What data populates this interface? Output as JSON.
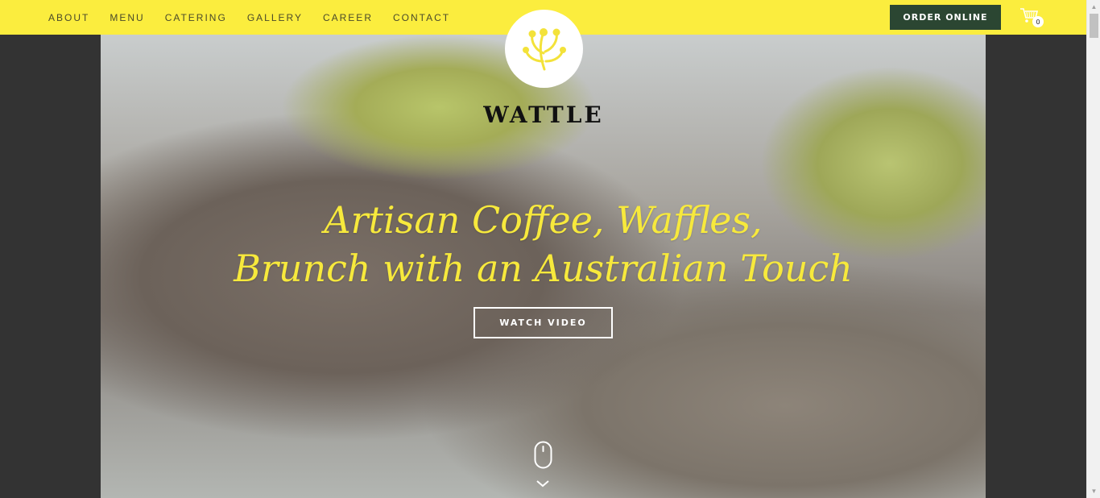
{
  "nav": {
    "items": [
      {
        "label": "ABOUT"
      },
      {
        "label": "MENU"
      },
      {
        "label": "CATERING"
      },
      {
        "label": "GALLERY"
      },
      {
        "label": "CAREER"
      },
      {
        "label": "CONTACT"
      }
    ]
  },
  "header": {
    "order_label": "ORDER ONLINE",
    "cart_count": "0",
    "brand": "WATTLE"
  },
  "hero": {
    "headline_line1": "Artisan Coffee, Waffles,",
    "headline_line2": "Brunch with an Australian Touch",
    "watch_label": "WATCH VIDEO"
  },
  "colors": {
    "topbar": "#fbed3e",
    "order_button": "#2b4632",
    "headline": "#f7e93c",
    "logo_icon": "#f3e23a"
  },
  "icons": [
    "wattle-logo-icon",
    "cart-icon",
    "mouse-icon",
    "chevron-down-icon"
  ]
}
